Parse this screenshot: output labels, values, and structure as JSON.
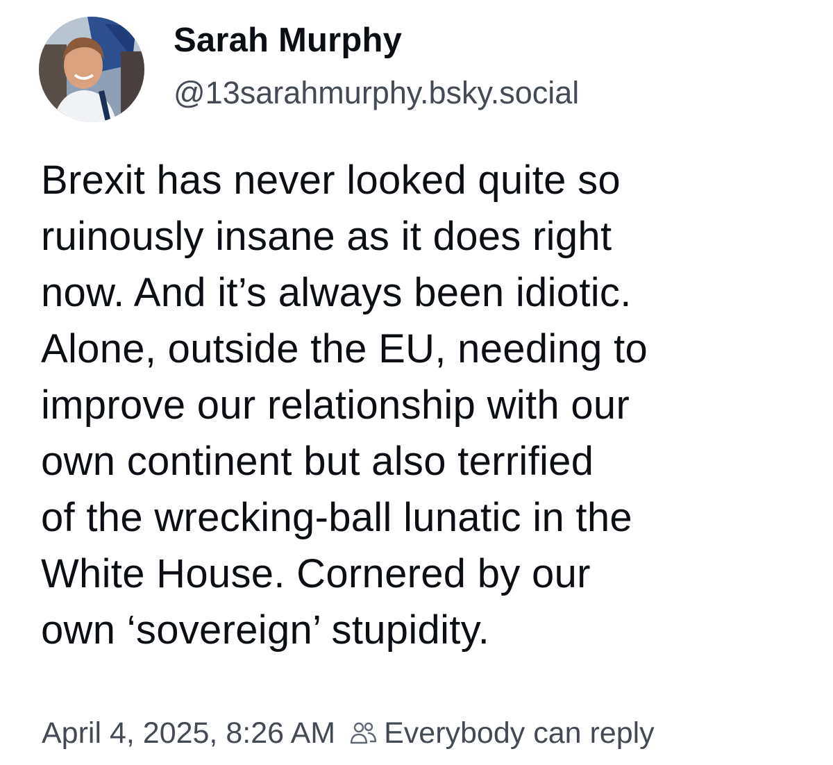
{
  "author": {
    "display_name": "Sarah Murphy",
    "handle": "@13sarahmurphy.bsky.social"
  },
  "post": {
    "lines": [
      "Brexit has never looked quite so",
      "ruinously insane as it does right",
      "now. And it’s always been idiotic.",
      "Alone, outside the EU, needing to",
      "improve our relationship with our",
      "own continent but also terrified",
      "of the wrecking-ball lunatic in the",
      "White House. Cornered by our",
      "own ‘sovereign’ stupidity."
    ]
  },
  "meta": {
    "timestamp": "April 4, 2025, 8:26 AM",
    "reply_setting": "Everybody can reply",
    "reply_icon": "people-icon"
  }
}
